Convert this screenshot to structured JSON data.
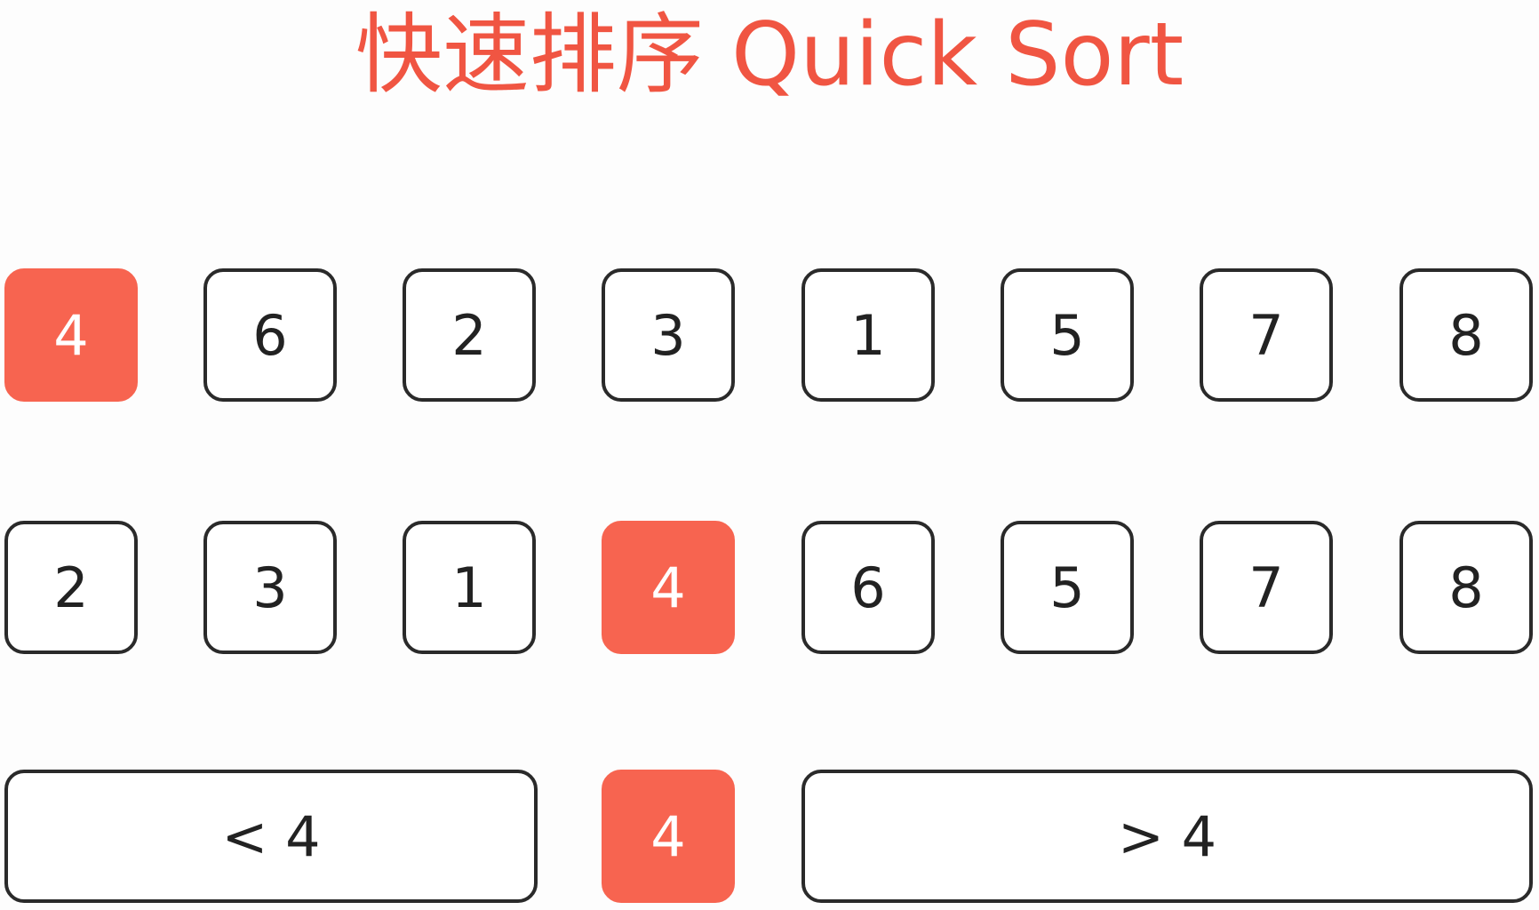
{
  "title": "快速排序 Quick Sort",
  "colors": {
    "pivot": "#f76450",
    "title": "#f05542",
    "border": "#2a2a2a"
  },
  "rows": [
    {
      "cells": [
        {
          "value": "4",
          "pivot": true
        },
        {
          "value": "6",
          "pivot": false
        },
        {
          "value": "2",
          "pivot": false
        },
        {
          "value": "3",
          "pivot": false
        },
        {
          "value": "1",
          "pivot": false
        },
        {
          "value": "5",
          "pivot": false
        },
        {
          "value": "7",
          "pivot": false
        },
        {
          "value": "8",
          "pivot": false
        }
      ]
    },
    {
      "cells": [
        {
          "value": "2",
          "pivot": false
        },
        {
          "value": "3",
          "pivot": false
        },
        {
          "value": "1",
          "pivot": false
        },
        {
          "value": "4",
          "pivot": true
        },
        {
          "value": "6",
          "pivot": false
        },
        {
          "value": "5",
          "pivot": false
        },
        {
          "value": "7",
          "pivot": false
        },
        {
          "value": "8",
          "pivot": false
        }
      ]
    }
  ],
  "partition": {
    "left_label": "< 4",
    "pivot_value": "4",
    "right_label": "> 4"
  }
}
